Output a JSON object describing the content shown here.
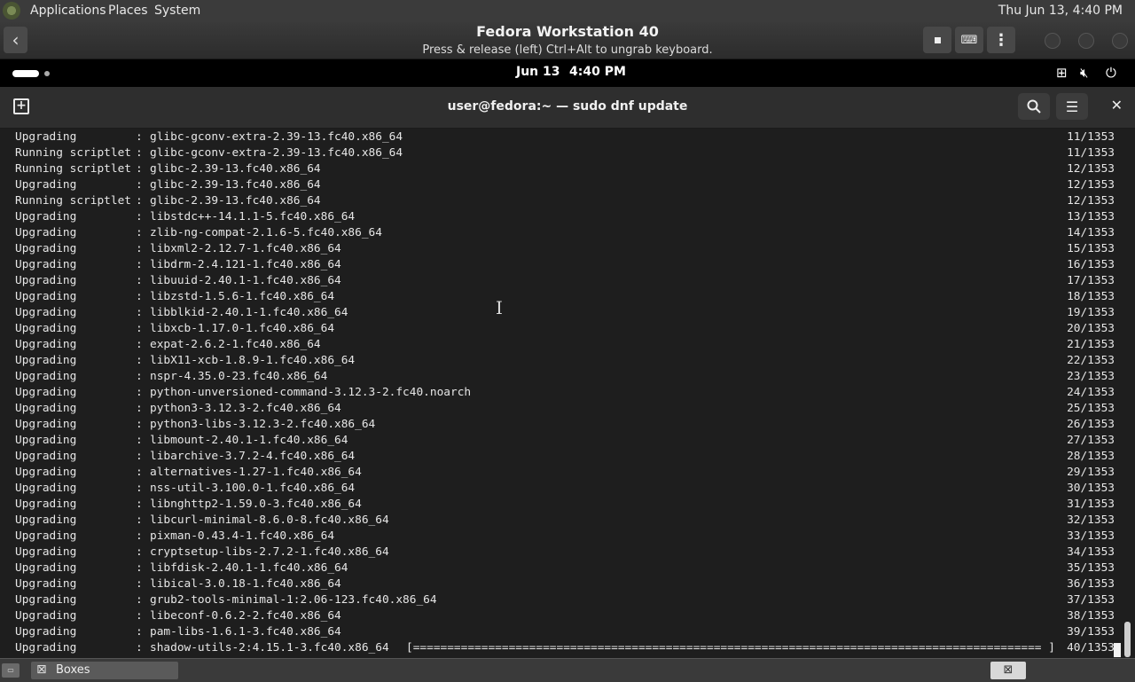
{
  "host_panel": {
    "menus": [
      "Applications",
      "Places",
      "System"
    ],
    "clock": "Thu Jun 13,  4:40 PM",
    "logo_icon": "distro-logo-icon"
  },
  "boxes_header": {
    "title": "Fedora Workstation 40",
    "subtitle": "Press & release (left) Ctrl+Alt to ungrab keyboard.",
    "back_icon": "back-arrow-icon",
    "stop_icon": "stop-icon",
    "keyboard_icon": "keyboard-icon",
    "menu_icon": "vertical-dots-icon"
  },
  "guest_bar": {
    "date": "Jun 13",
    "time": "4:40 PM"
  },
  "terminal": {
    "title": "user@fedora:~ — sudo dnf update",
    "lines": [
      {
        "action": "Upgrading",
        "pkg": "glibc-gconv-extra-2.39-13.fc40.x86_64",
        "count": "11/1353"
      },
      {
        "action": "Running scriptlet",
        "pkg": "glibc-gconv-extra-2.39-13.fc40.x86_64",
        "count": "11/1353"
      },
      {
        "action": "Running scriptlet",
        "pkg": "glibc-2.39-13.fc40.x86_64",
        "count": "12/1353"
      },
      {
        "action": "Upgrading",
        "pkg": "glibc-2.39-13.fc40.x86_64",
        "count": "12/1353"
      },
      {
        "action": "Running scriptlet",
        "pkg": "glibc-2.39-13.fc40.x86_64",
        "count": "12/1353"
      },
      {
        "action": "Upgrading",
        "pkg": "libstdc++-14.1.1-5.fc40.x86_64",
        "count": "13/1353"
      },
      {
        "action": "Upgrading",
        "pkg": "zlib-ng-compat-2.1.6-5.fc40.x86_64",
        "count": "14/1353"
      },
      {
        "action": "Upgrading",
        "pkg": "libxml2-2.12.7-1.fc40.x86_64",
        "count": "15/1353"
      },
      {
        "action": "Upgrading",
        "pkg": "libdrm-2.4.121-1.fc40.x86_64",
        "count": "16/1353"
      },
      {
        "action": "Upgrading",
        "pkg": "libuuid-2.40.1-1.fc40.x86_64",
        "count": "17/1353"
      },
      {
        "action": "Upgrading",
        "pkg": "libzstd-1.5.6-1.fc40.x86_64",
        "count": "18/1353"
      },
      {
        "action": "Upgrading",
        "pkg": "libblkid-2.40.1-1.fc40.x86_64",
        "count": "19/1353"
      },
      {
        "action": "Upgrading",
        "pkg": "libxcb-1.17.0-1.fc40.x86_64",
        "count": "20/1353"
      },
      {
        "action": "Upgrading",
        "pkg": "expat-2.6.2-1.fc40.x86_64",
        "count": "21/1353"
      },
      {
        "action": "Upgrading",
        "pkg": "libX11-xcb-1.8.9-1.fc40.x86_64",
        "count": "22/1353"
      },
      {
        "action": "Upgrading",
        "pkg": "nspr-4.35.0-23.fc40.x86_64",
        "count": "23/1353"
      },
      {
        "action": "Upgrading",
        "pkg": "python-unversioned-command-3.12.3-2.fc40.noarch",
        "count": "24/1353"
      },
      {
        "action": "Upgrading",
        "pkg": "python3-3.12.3-2.fc40.x86_64",
        "count": "25/1353"
      },
      {
        "action": "Upgrading",
        "pkg": "python3-libs-3.12.3-2.fc40.x86_64",
        "count": "26/1353"
      },
      {
        "action": "Upgrading",
        "pkg": "libmount-2.40.1-1.fc40.x86_64",
        "count": "27/1353"
      },
      {
        "action": "Upgrading",
        "pkg": "libarchive-3.7.2-4.fc40.x86_64",
        "count": "28/1353"
      },
      {
        "action": "Upgrading",
        "pkg": "alternatives-1.27-1.fc40.x86_64",
        "count": "29/1353"
      },
      {
        "action": "Upgrading",
        "pkg": "nss-util-3.100.0-1.fc40.x86_64",
        "count": "30/1353"
      },
      {
        "action": "Upgrading",
        "pkg": "libnghttp2-1.59.0-3.fc40.x86_64",
        "count": "31/1353"
      },
      {
        "action": "Upgrading",
        "pkg": "libcurl-minimal-8.6.0-8.fc40.x86_64",
        "count": "32/1353"
      },
      {
        "action": "Upgrading",
        "pkg": "pixman-0.43.4-1.fc40.x86_64",
        "count": "33/1353"
      },
      {
        "action": "Upgrading",
        "pkg": "cryptsetup-libs-2.7.2-1.fc40.x86_64",
        "count": "34/1353"
      },
      {
        "action": "Upgrading",
        "pkg": "libfdisk-2.40.1-1.fc40.x86_64",
        "count": "35/1353"
      },
      {
        "action": "Upgrading",
        "pkg": "libical-3.0.18-1.fc40.x86_64",
        "count": "36/1353"
      },
      {
        "action": "Upgrading",
        "pkg": "grub2-tools-minimal-1:2.06-123.fc40.x86_64",
        "count": "37/1353"
      },
      {
        "action": "Upgrading",
        "pkg": "libeconf-0.6.2-2.fc40.x86_64",
        "count": "38/1353"
      },
      {
        "action": "Upgrading",
        "pkg": "pam-libs-1.6.1-3.fc40.x86_64",
        "count": "39/1353"
      },
      {
        "action": "Upgrading",
        "pkg": "shadow-utils-2:4.15.1-3.fc40.x86_64",
        "count": "40/1353",
        "progress": "[============================================================================================ ]"
      }
    ]
  },
  "taskbar": {
    "task_label": "Boxes"
  }
}
